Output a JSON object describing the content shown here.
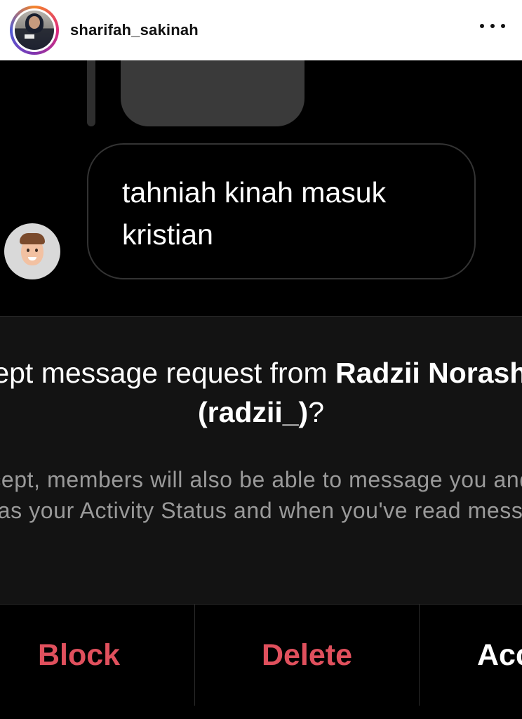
{
  "header": {
    "username": "sharifah_sakinah",
    "more_label": "more options"
  },
  "chat": {
    "message": "tahniah kinah masuk kristian"
  },
  "request": {
    "title_prefix": "Accept message request from ",
    "title_name": "Radzii Norashikin (radzii_)",
    "title_suffix": "?",
    "body": "If you accept, members will also be able to message you and see info such as your Activity Status and when you've read messages."
  },
  "actions": {
    "block": "Block",
    "delete": "Delete",
    "accept": "Accept"
  },
  "colors": {
    "destructive": "#e0505d",
    "panel_bg": "#131313",
    "body_text": "#9a9a9a"
  }
}
